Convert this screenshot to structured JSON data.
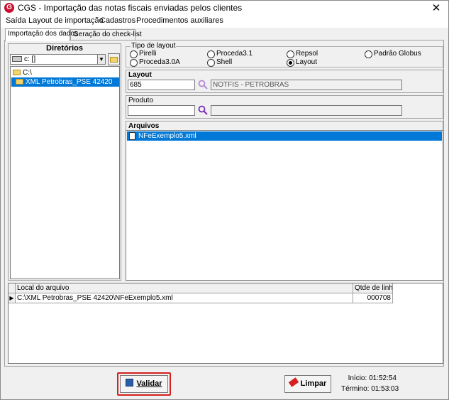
{
  "window": {
    "title": "CGS - Importação das notas fiscais enviadas pelos clientes",
    "app_icon_letter": "G",
    "close_glyph": "✕"
  },
  "menu": {
    "items": [
      "Saída",
      "Layout de importação",
      "Cadastros",
      "Procedimentos auxiliares"
    ]
  },
  "tabs": [
    "Importação dos dados",
    "Geração do check-list"
  ],
  "directories": {
    "header": "Diretórios",
    "drive": "c: []",
    "tree": [
      "C:\\",
      "XML Petrobras_PSE 42420"
    ]
  },
  "layout_type": {
    "legend": "Tipo de layout",
    "options": [
      "Pirelli",
      "Proceda3.1",
      "Repsol",
      "Padrão Globus",
      "Proceda3.0A",
      "Shell",
      "Layout"
    ],
    "selected": "Layout"
  },
  "layout": {
    "title": "Layout",
    "code": "685",
    "description": "NOTFIS - PETROBRAS"
  },
  "produto": {
    "title": "Produto",
    "code": "",
    "description": ""
  },
  "arquivos": {
    "title": "Arquivos",
    "items": [
      "NFeExemplo5.xml"
    ]
  },
  "grid": {
    "columns": [
      "Local do arquivo",
      "Qtde de linh..."
    ],
    "rows": [
      {
        "path": "C:\\XML Petrobras_PSE 42420\\NFeExemplo5.xml",
        "qty": "000708"
      }
    ]
  },
  "actions": {
    "validar": "Validar",
    "limpar": "Limpar"
  },
  "timing": {
    "inicio_label": "Início:",
    "inicio": "01:52:54",
    "termino_label": "Término:",
    "termino": "01:53:03"
  },
  "colors": {
    "selection": "#0078d7",
    "focus_border": "#d42020",
    "search_icon": "#7a2bb5"
  }
}
